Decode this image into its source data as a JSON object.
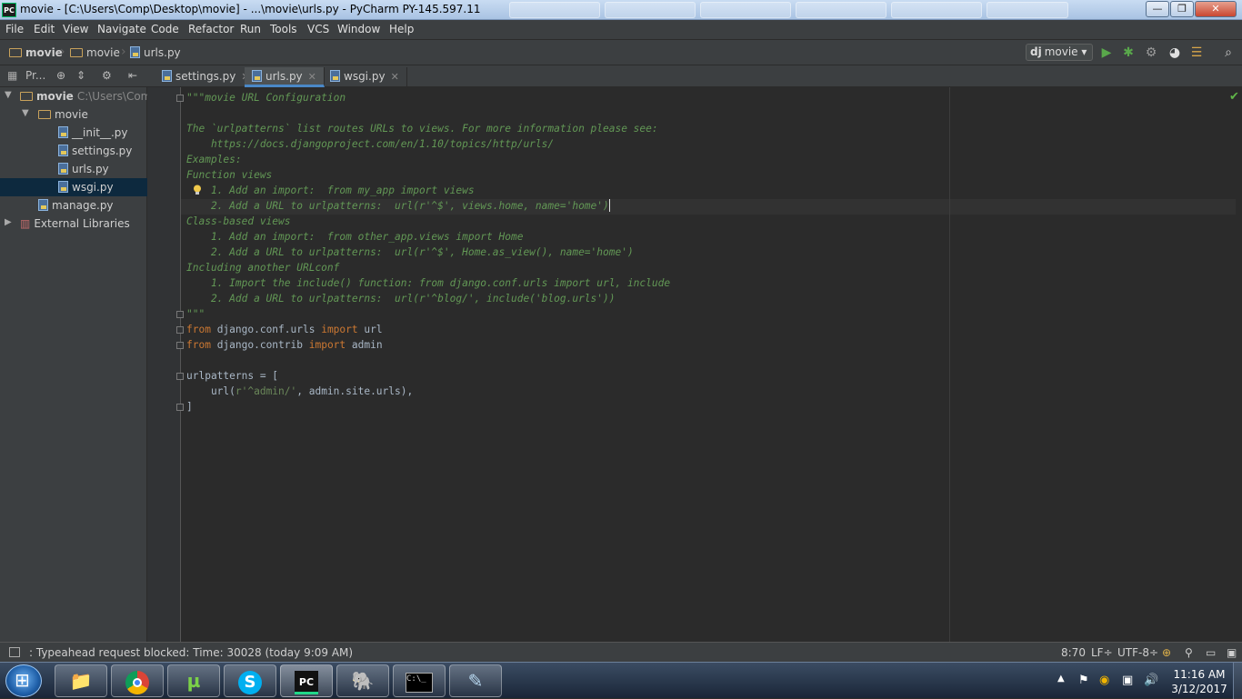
{
  "window": {
    "title": "movie - [C:\\Users\\Comp\\Desktop\\movie] - ...\\movie\\urls.py - PyCharm PY-145.597.11",
    "app_icon": "PC",
    "minimize": "—",
    "maximize": "❐",
    "close": "✕"
  },
  "menu": [
    "File",
    "Edit",
    "View",
    "Navigate",
    "Code",
    "Refactor",
    "Run",
    "Tools",
    "VCS",
    "Window",
    "Help"
  ],
  "breadcrumbs": [
    "movie",
    "movie",
    "urls.py"
  ],
  "run_config": {
    "badge": "dj",
    "name": "movie"
  },
  "project_header": {
    "label": "Pr..."
  },
  "tree": [
    {
      "label": "movie",
      "path": "C:\\Users\\Comp",
      "type": "folder",
      "expanded": true,
      "bold": true
    },
    {
      "label": "movie",
      "type": "folder",
      "expanded": true
    },
    {
      "label": "__init__.py",
      "type": "py"
    },
    {
      "label": "settings.py",
      "type": "py"
    },
    {
      "label": "urls.py",
      "type": "py"
    },
    {
      "label": "wsgi.py",
      "type": "py",
      "selected": true
    },
    {
      "label": "manage.py",
      "type": "py"
    },
    {
      "label": "External Libraries",
      "type": "lib",
      "expanded": false
    }
  ],
  "tabs": [
    {
      "label": "settings.py",
      "active": false
    },
    {
      "label": "urls.py",
      "active": true
    },
    {
      "label": "wsgi.py",
      "active": false
    }
  ],
  "code": [
    "\"\"\"movie URL Configuration",
    "",
    "The `urlpatterns` list routes URLs to views. For more information please see:",
    "    https://docs.djangoproject.com/en/1.10/topics/http/urls/",
    "Examples:",
    "Function views",
    "    1. Add an import:  from my_app import views",
    "    2. Add a URL to urlpatterns:  url(r'^$', views.home, name='home')",
    "Class-based views",
    "    1. Add an import:  from other_app.views import Home",
    "    2. Add a URL to urlpatterns:  url(r'^$', Home.as_view(), name='home')",
    "Including another URLconf",
    "    1. Import the include() function: from django.conf.urls import url, include",
    "    2. Add a URL to urlpatterns:  url(r'^blog/', include('blog.urls'))",
    "\"\"\"",
    "from django.conf.urls import url",
    "from django.contrib import admin",
    "",
    "urlpatterns = [",
    "    url(r'^admin/', admin.site.urls),",
    "]"
  ],
  "status": {
    "message": ": Typeahead request blocked: Time: 30028 (today 9:09 AM)",
    "position": "8:70",
    "line_sep": "LF÷",
    "encoding": "UTF-8÷"
  },
  "taskbar": {
    "apps": [
      "explorer",
      "chrome",
      "utorrent",
      "skype",
      "pycharm",
      "postgresql",
      "cmd",
      "notepad"
    ],
    "time": "11:16 AM",
    "date": "3/12/2017"
  },
  "colors": {
    "accent": "#4a88c7",
    "docstring": "#629755",
    "keyword": "#cc7832",
    "string": "#6a8759"
  }
}
